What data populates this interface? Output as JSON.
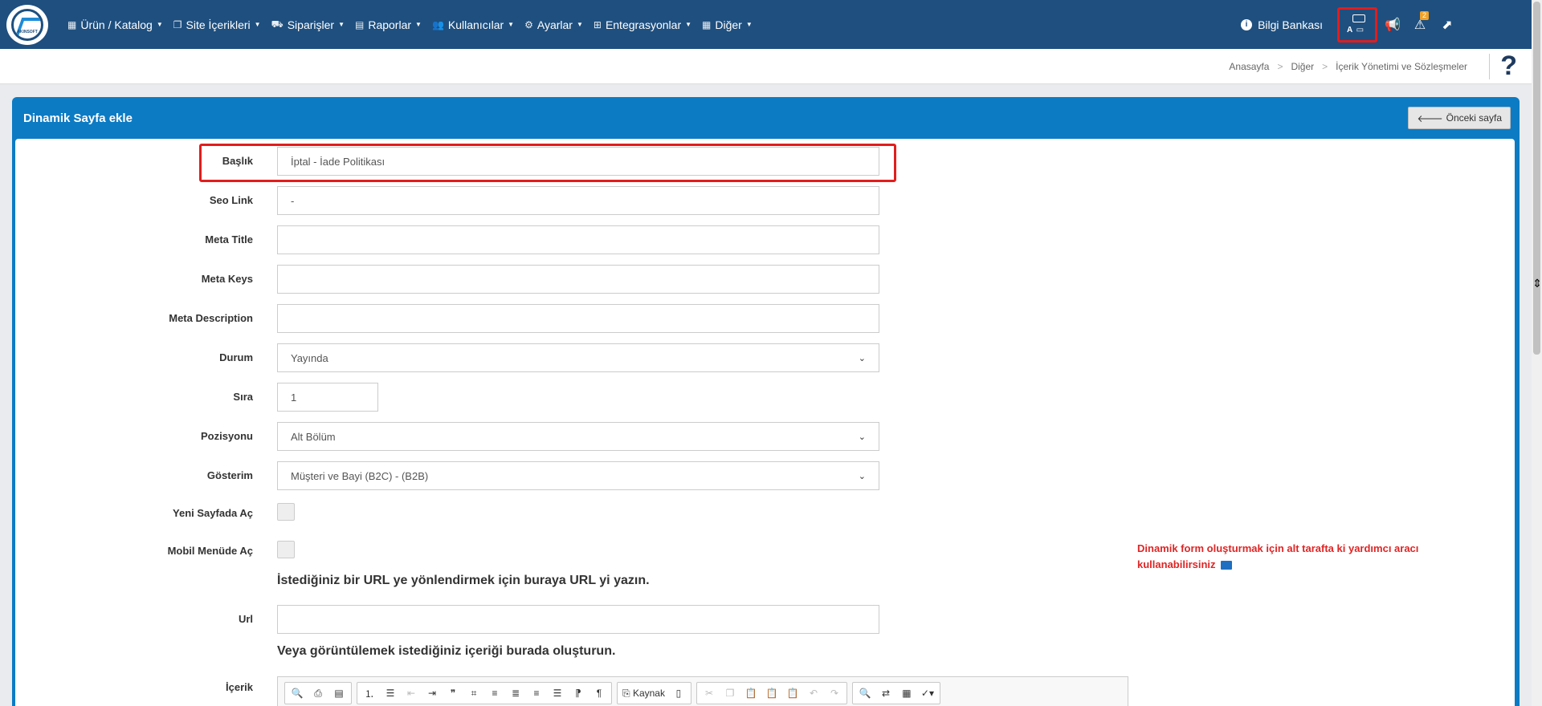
{
  "nav": {
    "logo_text": "AKINSOFT",
    "items": [
      {
        "icon": "boxes-icon",
        "glyph": "▦",
        "label": "Ürün / Katalog"
      },
      {
        "icon": "copy-icon",
        "glyph": "❐",
        "label": "Site İçerikleri"
      },
      {
        "icon": "truck-icon",
        "glyph": "⛟",
        "label": "Siparişler"
      },
      {
        "icon": "report-icon",
        "glyph": "▤",
        "label": "Raporlar"
      },
      {
        "icon": "users-icon",
        "glyph": "👥",
        "label": "Kullanıcılar"
      },
      {
        "icon": "gears-icon",
        "glyph": "⚙",
        "label": "Ayarlar"
      },
      {
        "icon": "sitemap-icon",
        "glyph": "⊞",
        "label": "Entegrasyonlar"
      },
      {
        "icon": "grid-icon",
        "glyph": "▦",
        "label": "Diğer"
      }
    ],
    "knowledge_base": "Bilgi Bankası",
    "alert_badge": "2"
  },
  "breadcrumb": {
    "home": "Anasayfa",
    "level1": "Diğer",
    "level2": "İçerik Yönetimi ve Sözleşmeler"
  },
  "panel": {
    "title": "Dinamik Sayfa ekle",
    "back_label": "Önceki sayfa"
  },
  "form": {
    "baslik_label": "Başlık",
    "baslik_value": "İptal - İade Politikası",
    "seo_label": "Seo Link",
    "seo_value": "-",
    "meta_title_label": "Meta Title",
    "meta_title_value": "",
    "meta_keys_label": "Meta Keys",
    "meta_keys_value": "",
    "meta_desc_label": "Meta Description",
    "meta_desc_value": "",
    "durum_label": "Durum",
    "durum_value": "Yayında",
    "sira_label": "Sıra",
    "sira_value": "1",
    "pozisyon_label": "Pozisyonu",
    "pozisyon_value": "Alt Bölüm",
    "gosterim_label": "Gösterim",
    "gosterim_value": "Müşteri ve Bayi (B2C) - (B2B)",
    "yeni_sayfa_label": "Yeni Sayfada Aç",
    "mobil_menu_label": "Mobil Menüde Aç",
    "url_heading": "İstediğiniz bir URL ye yönlendirmek için buraya URL yi yazın.",
    "url_label": "Url",
    "url_value": "",
    "content_heading": "Veya görüntülemek istediğiniz içeriği burada oluşturun.",
    "content_label": "İçerik",
    "source_label": "Kaynak"
  },
  "side_note": "Dinamik form oluşturmak için alt tarafta ki yardımcı aracı kullanabilirsiniz"
}
